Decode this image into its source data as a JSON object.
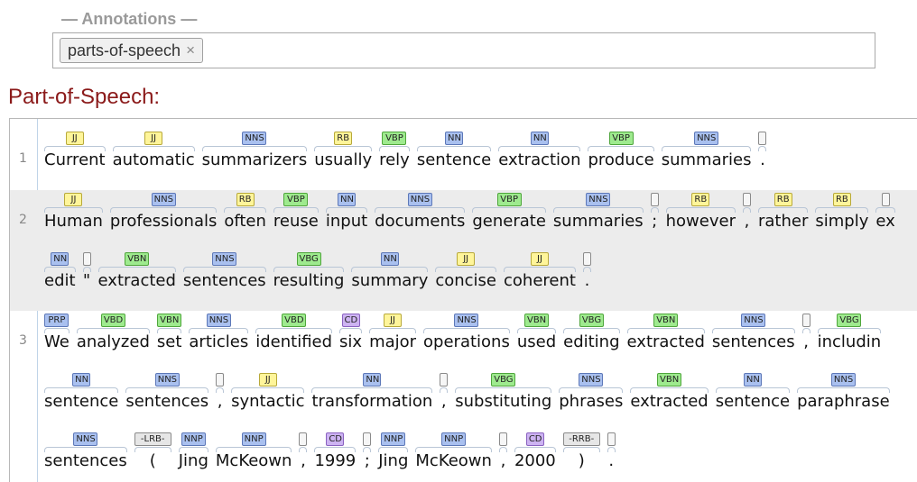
{
  "annotations": {
    "legend": "— Annotations —",
    "chips": [
      {
        "label": "parts-of-speech",
        "remove": "×"
      }
    ]
  },
  "section_title": "Part-of-Speech:",
  "lines": [
    {
      "number": "1",
      "rows": [
        [
          {
            "w": "Current",
            "t": "JJ"
          },
          {
            "w": "automatic",
            "t": "JJ"
          },
          {
            "w": "summarizers",
            "t": "NNS"
          },
          {
            "w": "usually",
            "t": "RB"
          },
          {
            "w": "rely",
            "t": "VBP"
          },
          {
            "w": "sentence",
            "t": "NN"
          },
          {
            "w": "extraction",
            "t": "NN"
          },
          {
            "w": "produce",
            "t": "VBP"
          },
          {
            "w": "summaries",
            "t": "NNS"
          },
          {
            "w": ".",
            "t": ""
          }
        ]
      ]
    },
    {
      "number": "2",
      "rows": [
        [
          {
            "w": "Human",
            "t": "JJ"
          },
          {
            "w": "professionals",
            "t": "NNS"
          },
          {
            "w": "often",
            "t": "RB"
          },
          {
            "w": "reuse",
            "t": "VBP"
          },
          {
            "w": "input",
            "t": "NN"
          },
          {
            "w": "documents",
            "t": "NNS"
          },
          {
            "w": "generate",
            "t": "VBP"
          },
          {
            "w": "summaries",
            "t": "NNS"
          },
          {
            "w": ";",
            "t": ""
          },
          {
            "w": "however",
            "t": "RB"
          },
          {
            "w": ",",
            "t": ""
          },
          {
            "w": "rather",
            "t": "RB"
          },
          {
            "w": "simply",
            "t": "RB"
          },
          {
            "w": "ex",
            "t": ""
          }
        ],
        [
          {
            "w": "edit",
            "t": "NN"
          },
          {
            "w": "\"",
            "t": ""
          },
          {
            "w": "extracted",
            "t": "VBN"
          },
          {
            "w": "sentences",
            "t": "NNS"
          },
          {
            "w": "resulting",
            "t": "VBG"
          },
          {
            "w": "summary",
            "t": "NN"
          },
          {
            "w": "concise",
            "t": "JJ"
          },
          {
            "w": "coherent",
            "t": "JJ"
          },
          {
            "w": ".",
            "t": ""
          }
        ]
      ]
    },
    {
      "number": "3",
      "rows": [
        [
          {
            "w": "We",
            "t": "PRP"
          },
          {
            "w": "analyzed",
            "t": "VBD"
          },
          {
            "w": "set",
            "t": "VBN"
          },
          {
            "w": "articles",
            "t": "NNS"
          },
          {
            "w": "identified",
            "t": "VBD"
          },
          {
            "w": "six",
            "t": "CD"
          },
          {
            "w": "major",
            "t": "JJ"
          },
          {
            "w": "operations",
            "t": "NNS"
          },
          {
            "w": "used",
            "t": "VBN"
          },
          {
            "w": "editing",
            "t": "VBG"
          },
          {
            "w": "extracted",
            "t": "VBN"
          },
          {
            "w": "sentences",
            "t": "NNS"
          },
          {
            "w": ",",
            "t": ""
          },
          {
            "w": "includin",
            "t": "VBG"
          }
        ],
        [
          {
            "w": "sentence",
            "t": "NN"
          },
          {
            "w": "sentences",
            "t": "NNS"
          },
          {
            "w": ",",
            "t": ""
          },
          {
            "w": "syntactic",
            "t": "JJ"
          },
          {
            "w": "transformation",
            "t": "NN"
          },
          {
            "w": ",",
            "t": ""
          },
          {
            "w": "substituting",
            "t": "VBG"
          },
          {
            "w": "phrases",
            "t": "NNS"
          },
          {
            "w": "extracted",
            "t": "VBN"
          },
          {
            "w": "sentence",
            "t": "NN"
          },
          {
            "w": "paraphrase",
            "t": "NNS"
          }
        ],
        [
          {
            "w": "sentences",
            "t": "NNS"
          },
          {
            "w": "(",
            "t": "-LRB-"
          },
          {
            "w": "Jing",
            "t": "NNP"
          },
          {
            "w": "McKeown",
            "t": "NNP"
          },
          {
            "w": ",",
            "t": ""
          },
          {
            "w": "1999",
            "t": "CD"
          },
          {
            "w": ";",
            "t": ""
          },
          {
            "w": "Jing",
            "t": "NNP"
          },
          {
            "w": "McKeown",
            "t": "NNP"
          },
          {
            "w": ",",
            "t": ""
          },
          {
            "w": "2000",
            "t": "CD"
          },
          {
            "w": ")",
            "t": "-RRB-"
          },
          {
            "w": ".",
            "t": ""
          }
        ]
      ]
    }
  ]
}
